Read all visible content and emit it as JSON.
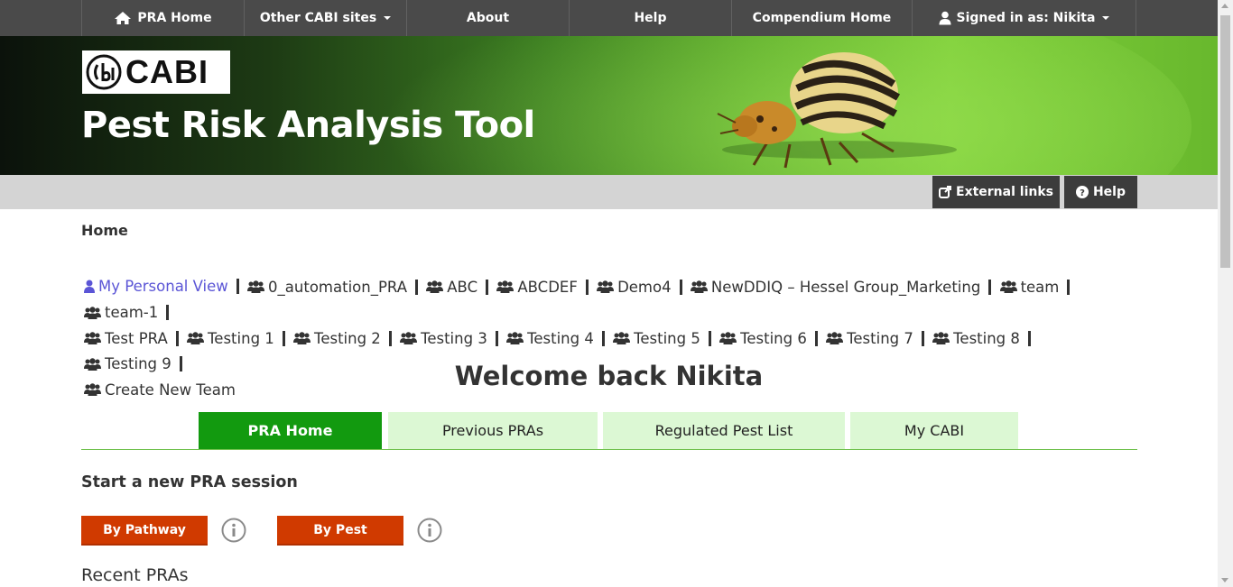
{
  "topnav": {
    "items": [
      {
        "label": "PRA Home",
        "icon": "home-icon"
      },
      {
        "label": "Other CABI sites",
        "dropdown": true
      },
      {
        "label": "About"
      },
      {
        "label": "Help"
      },
      {
        "label": "Compendium Home"
      },
      {
        "label": "Signed in as: Nikita",
        "icon": "user-icon",
        "dropdown": true
      }
    ]
  },
  "banner": {
    "logo_text": "CABI",
    "title": "Pest Risk Analysis Tool"
  },
  "toolbar": {
    "external_links_label": "External links",
    "help_label": "Help"
  },
  "breadcrumb": "Home",
  "teams": [
    {
      "label": "My Personal View",
      "icon": "user-icon"
    },
    {
      "label": "0_automation_PRA",
      "icon": "users-icon"
    },
    {
      "label": "ABC",
      "icon": "users-icon"
    },
    {
      "label": "ABCDEF",
      "icon": "users-icon"
    },
    {
      "label": "Demo4",
      "icon": "users-icon"
    },
    {
      "label": "NewDDIQ – Hessel Group_Marketing",
      "icon": "users-icon"
    },
    {
      "label": "team",
      "icon": "users-icon"
    },
    {
      "label": "team-1",
      "icon": "users-icon"
    },
    {
      "label": "Test PRA",
      "icon": "users-icon"
    },
    {
      "label": "Testing 1",
      "icon": "users-icon"
    },
    {
      "label": "Testing 2",
      "icon": "users-icon"
    },
    {
      "label": "Testing 3",
      "icon": "users-icon"
    },
    {
      "label": "Testing 4",
      "icon": "users-icon"
    },
    {
      "label": "Testing 5",
      "icon": "users-icon"
    },
    {
      "label": "Testing 6",
      "icon": "users-icon"
    },
    {
      "label": "Testing 7",
      "icon": "users-icon"
    },
    {
      "label": "Testing 8",
      "icon": "users-icon"
    },
    {
      "label": "Testing 9",
      "icon": "users-icon"
    },
    {
      "label": "Create New Team",
      "icon": "users-icon"
    }
  ],
  "welcome": "Welcome back Nikita",
  "tabs": [
    {
      "label": "PRA Home",
      "active": true
    },
    {
      "label": "Previous PRAs"
    },
    {
      "label": "Regulated Pest List"
    },
    {
      "label": "My CABI"
    }
  ],
  "start_section": {
    "title": "Start a new PRA session",
    "by_pathway_label": "By Pathway",
    "by_pest_label": "By Pest"
  },
  "recent_title": "Recent PRAs",
  "colors": {
    "nav_bg": "#4a4a4a",
    "tab_active": "#129a0f",
    "tab_inactive": "#dcf8d4",
    "button_orange": "#d03a00",
    "personal_link": "#5b55d6"
  }
}
